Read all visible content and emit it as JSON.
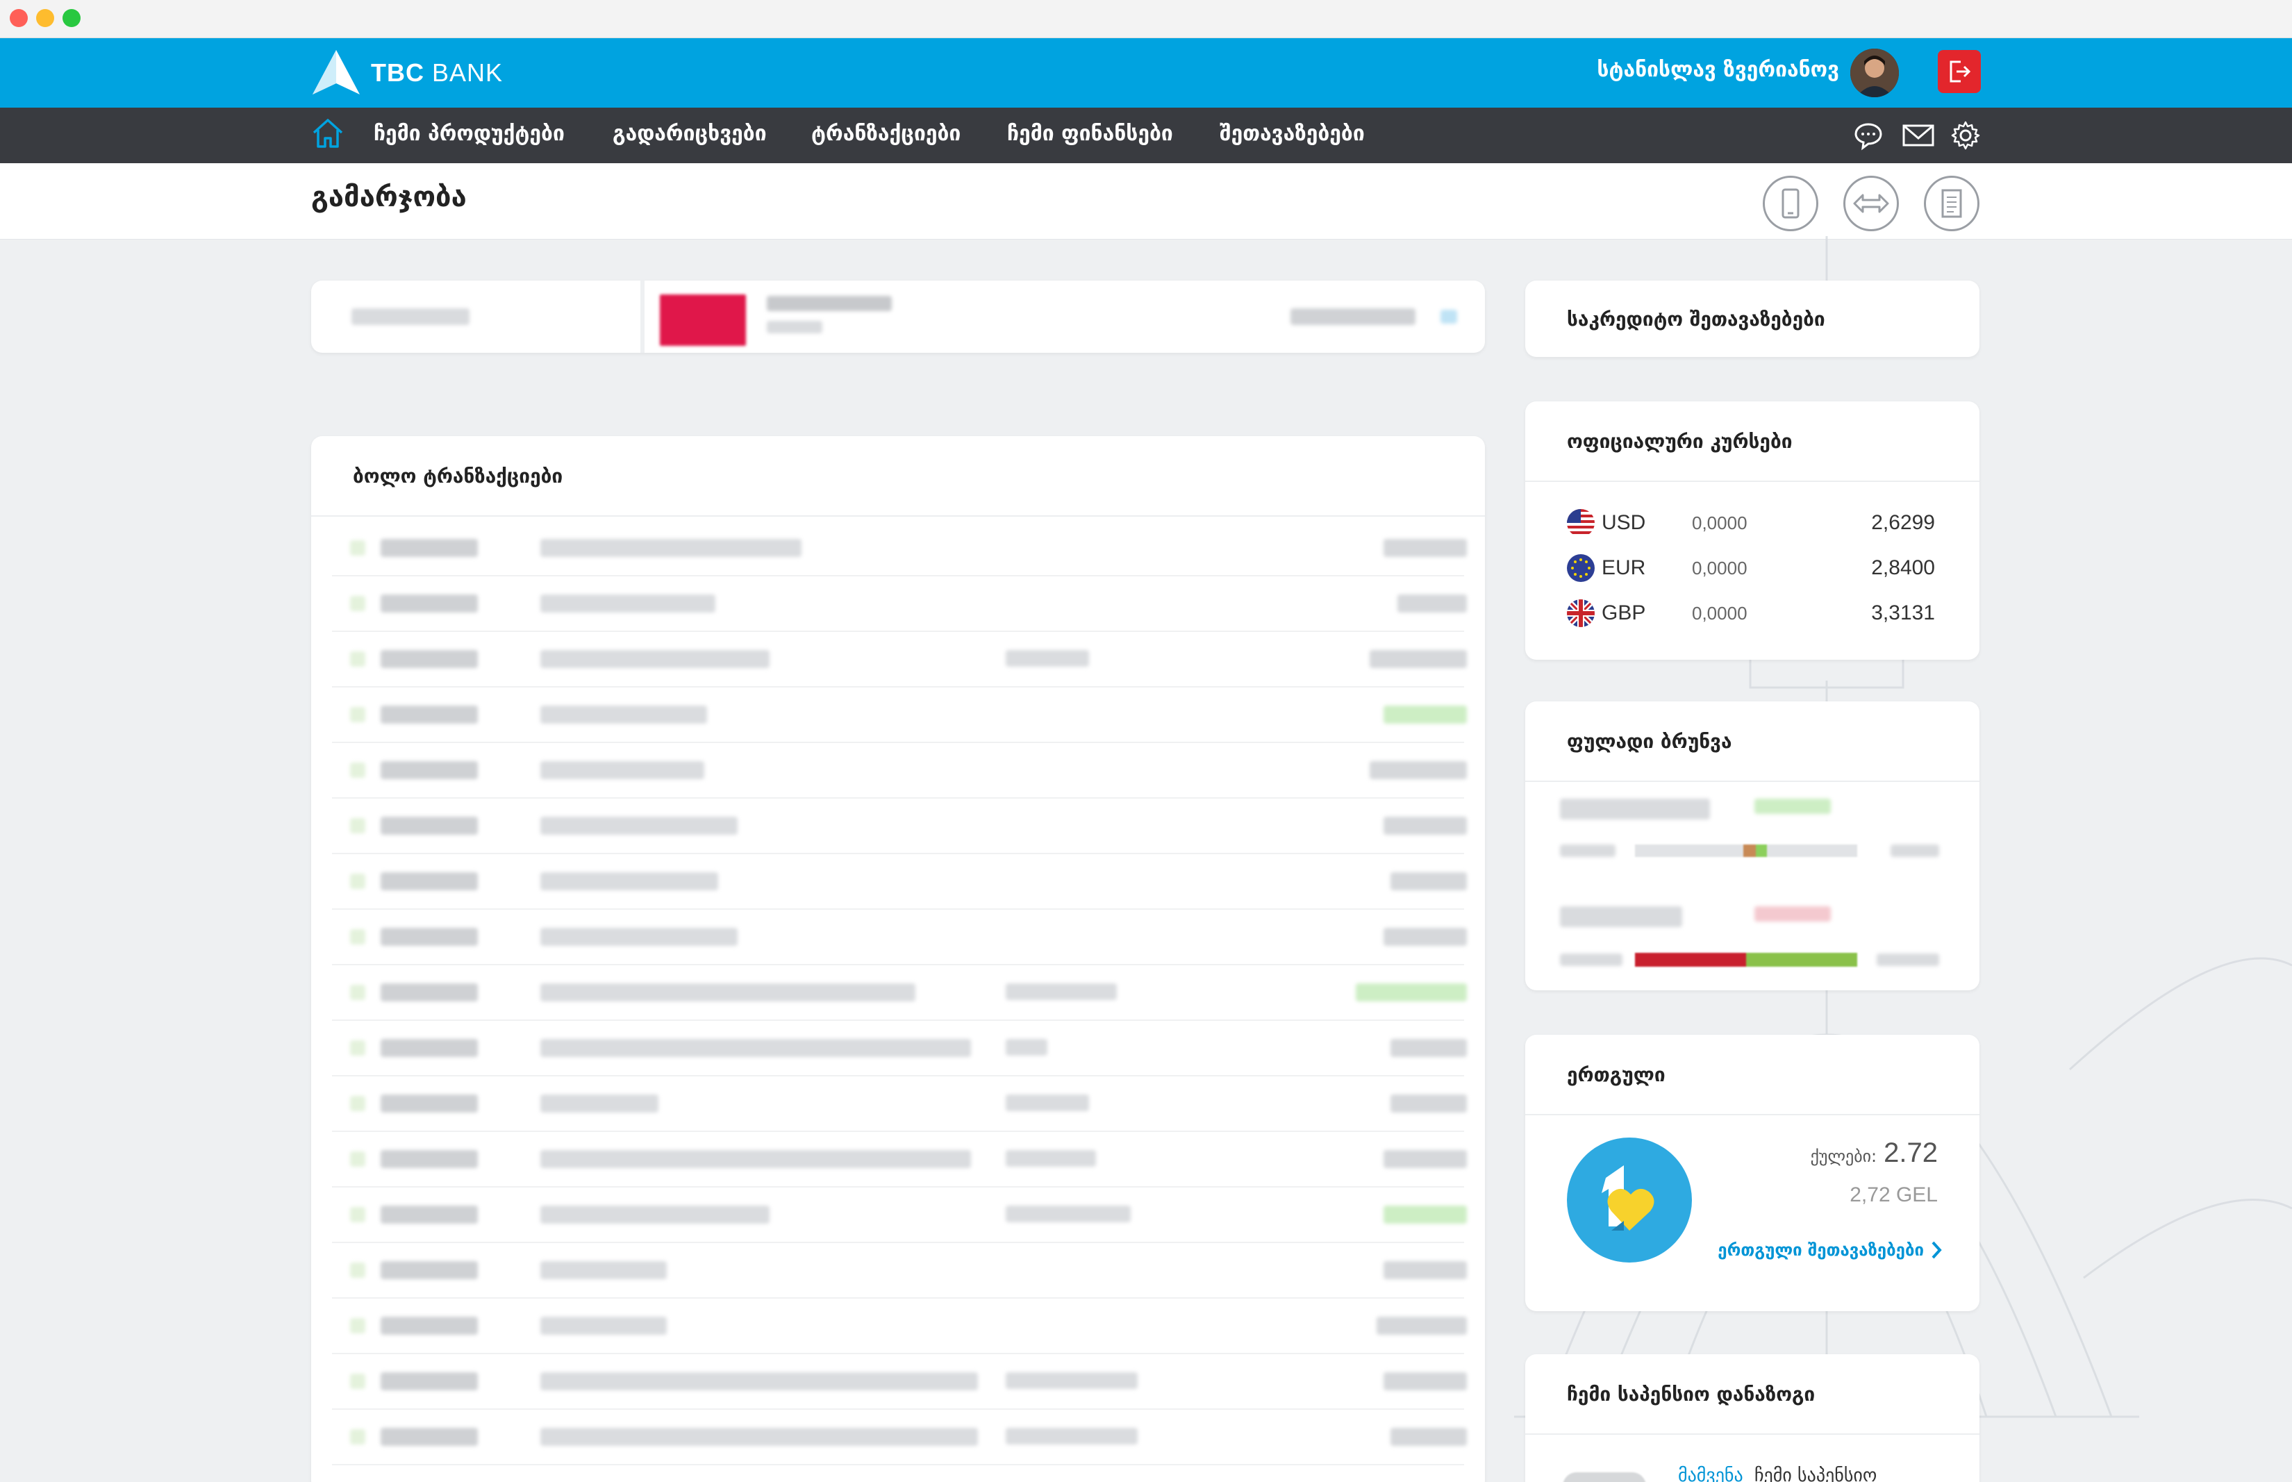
{
  "window": {
    "dot_colors": [
      "#ff5f57",
      "#febc2e",
      "#28c840"
    ]
  },
  "brand": {
    "logo_bold": "TBC",
    "logo_light": " BANK",
    "accent": "#00a3e0",
    "nav_bg": "#393b40",
    "logout_color": "#e3262c"
  },
  "user": {
    "name": "სტანისლავ ზვერიანოვ"
  },
  "nav": {
    "items": [
      "ჩემი პროდუქტები",
      "გადარიცხვები",
      "ტრანზაქციები",
      "ჩემი ფინანსები",
      "შეთავაზებები"
    ],
    "icons": [
      "home-icon",
      "chat-icon",
      "mail-icon",
      "settings-icon"
    ]
  },
  "page": {
    "title": "გამარჯობა"
  },
  "transactions": {
    "title": "ბოლო ტრანზაქციები"
  },
  "credit_offers": {
    "title": "საკრედიტო შეთავაზებები"
  },
  "rates": {
    "title": "ოფიციალური კურსები",
    "rows": [
      {
        "code": "USD",
        "change": "0,0000",
        "value": "2,6299",
        "flag": "us-flag-icon"
      },
      {
        "code": "EUR",
        "change": "0,0000",
        "value": "2,8400",
        "flag": "eu-flag-icon"
      },
      {
        "code": "GBP",
        "change": "0,0000",
        "value": "3,3131",
        "flag": "gb-flag-icon"
      }
    ]
  },
  "cashflow": {
    "title": "ფულადი ბრუნვა"
  },
  "loyalty": {
    "title": "ერთგული",
    "points_label": "ქულები:",
    "points_value": "2.72",
    "gel_value": "2,72 GEL",
    "link": "ერთგული შეთავაზებები"
  },
  "pension": {
    "title": "ჩემი საპენსიო დანაზოგი",
    "link_partial": "მამვენა",
    "text_partial": "ჩემი საპენსიო"
  }
}
